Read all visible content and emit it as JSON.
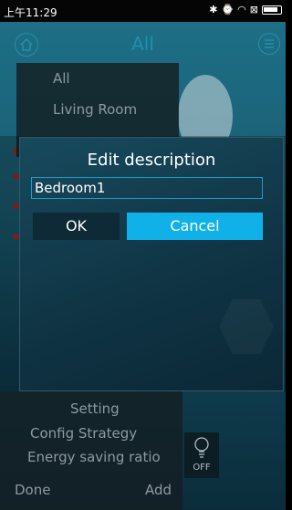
{
  "status_bar": {
    "time": "上午11:29"
  },
  "header": {
    "title": "All"
  },
  "room_dropdown": {
    "items": [
      "All",
      "Living Room"
    ]
  },
  "dialog": {
    "title": "Edit description",
    "input_value": "Bedroom1",
    "ok_label": "OK",
    "cancel_label": "Cancel"
  },
  "bottom_menu": {
    "setting": "Setting",
    "config_strategy": "Config Strategy",
    "energy_saving_ratio": "Energy saving ratio",
    "done": "Done",
    "add": "Add"
  },
  "device": {
    "state": "OFF"
  },
  "colors": {
    "accent": "#10b1e8",
    "title_blue": "#1e90b0",
    "ok_bg": "#0d2a36"
  }
}
